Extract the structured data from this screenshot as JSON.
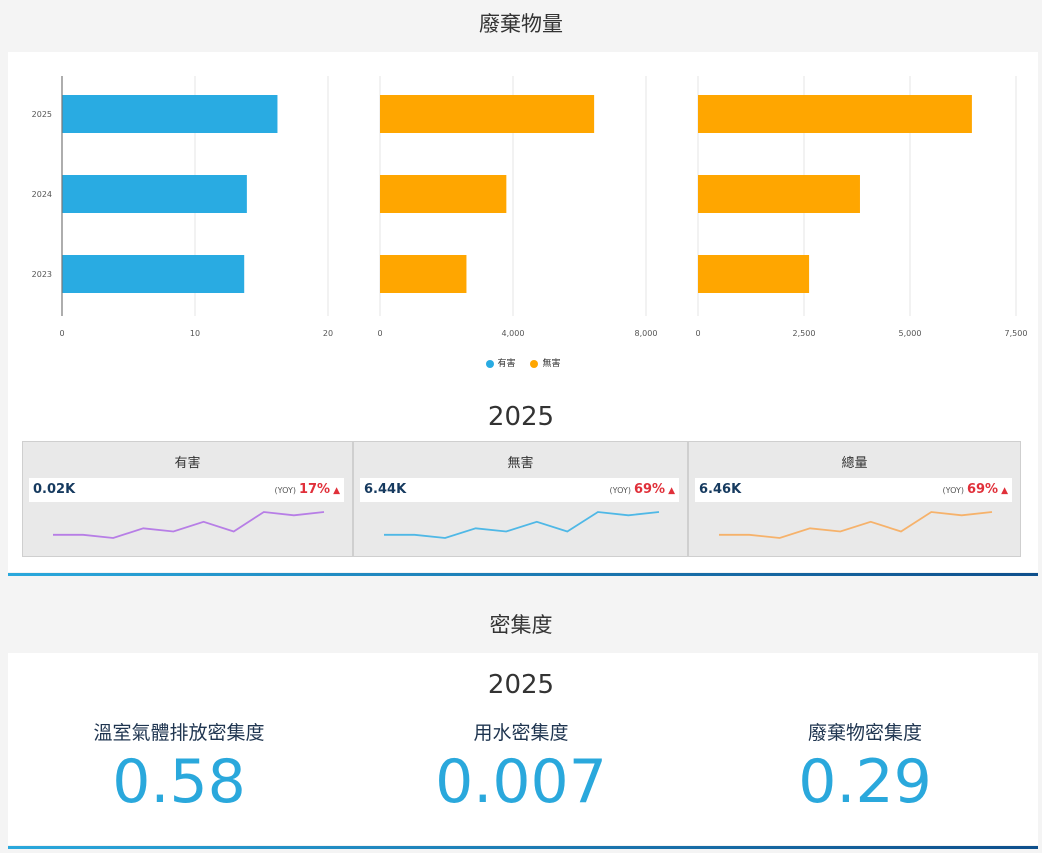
{
  "sections": {
    "waste_title": "廢棄物量",
    "intensity_title": "密集度"
  },
  "chart_data": [
    {
      "type": "bar",
      "orientation": "horizontal",
      "categories": [
        "2025",
        "2024",
        "2023"
      ],
      "series": [
        {
          "name": "有害",
          "values": [
            16.2,
            13.9,
            13.7
          ],
          "color": "#29abe2"
        }
      ],
      "xlim": [
        0,
        20
      ],
      "xticks": [
        "0",
        "10",
        "20"
      ]
    },
    {
      "type": "bar",
      "orientation": "horizontal",
      "categories": [
        "2025",
        "2024",
        "2023"
      ],
      "series": [
        {
          "name": "無害",
          "values": [
            6440,
            3800,
            2600
          ],
          "color": "#ffa600"
        }
      ],
      "xlim": [
        0,
        8000
      ],
      "xticks": [
        "0",
        "4,000",
        "8,000"
      ]
    },
    {
      "type": "bar",
      "orientation": "horizontal",
      "categories": [
        "2025",
        "2024",
        "2023"
      ],
      "series": [
        {
          "name": "無害",
          "values": [
            6460,
            3820,
            2620
          ],
          "color": "#ffa600"
        }
      ],
      "xlim": [
        0,
        7500
      ],
      "xticks": [
        "0",
        "2,500",
        "5,000",
        "7,500"
      ]
    }
  ],
  "legend": [
    {
      "label": "有害",
      "color": "#29abe2"
    },
    {
      "label": "無害",
      "color": "#ffa600"
    }
  ],
  "kpi_year": "2025",
  "kpis": [
    {
      "title": "有害",
      "value": "0.02K",
      "yoy_label": "(YOY)",
      "yoy": "17%",
      "arrow": "▲",
      "color": "#b77ee6",
      "trend": [
        3,
        3,
        2,
        5,
        4,
        7,
        4,
        10,
        9,
        10
      ]
    },
    {
      "title": "無害",
      "value": "6.44K",
      "yoy_label": "(YOY)",
      "yoy": "69%",
      "arrow": "▲",
      "color": "#4fb8e6",
      "trend": [
        3,
        3,
        2,
        5,
        4,
        7,
        4,
        10,
        9,
        10
      ]
    },
    {
      "title": "總量",
      "value": "6.46K",
      "yoy_label": "(YOY)",
      "yoy": "69%",
      "arrow": "▲",
      "color": "#f6b26b",
      "trend": [
        3,
        3,
        2,
        5,
        4,
        7,
        4,
        10,
        9,
        10
      ]
    }
  ],
  "intensity": {
    "year": "2025",
    "metrics": [
      {
        "label": "溫室氣體排放密集度",
        "value": "0.58"
      },
      {
        "label": "用水密集度",
        "value": "0.007"
      },
      {
        "label": "廢棄物密集度",
        "value": "0.29"
      }
    ]
  }
}
